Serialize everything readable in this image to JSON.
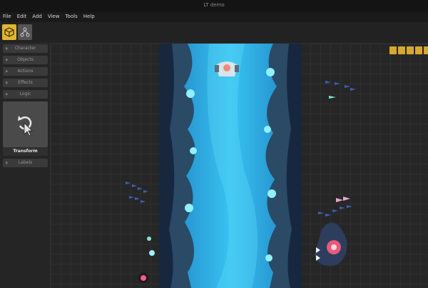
{
  "window": {
    "title": "LT demo"
  },
  "menu": [
    "File",
    "Edit",
    "Add",
    "View",
    "Tools",
    "Help"
  ],
  "toolbar": {
    "tools": [
      "cube-icon",
      "nodes-icon"
    ]
  },
  "sidebar": {
    "categories": [
      "Character",
      "Objects",
      "Actions",
      "Effects",
      "Logic"
    ],
    "selected": "Transform",
    "after": [
      "Labels"
    ]
  },
  "viewport_tools": [
    "lock-icon",
    "snap-icon",
    "expand-icon",
    "camera-icon",
    "warning-icon"
  ],
  "colors": {
    "accent": "#e0b533",
    "water": "#2fb6e8",
    "rock": "#2a4a66"
  }
}
